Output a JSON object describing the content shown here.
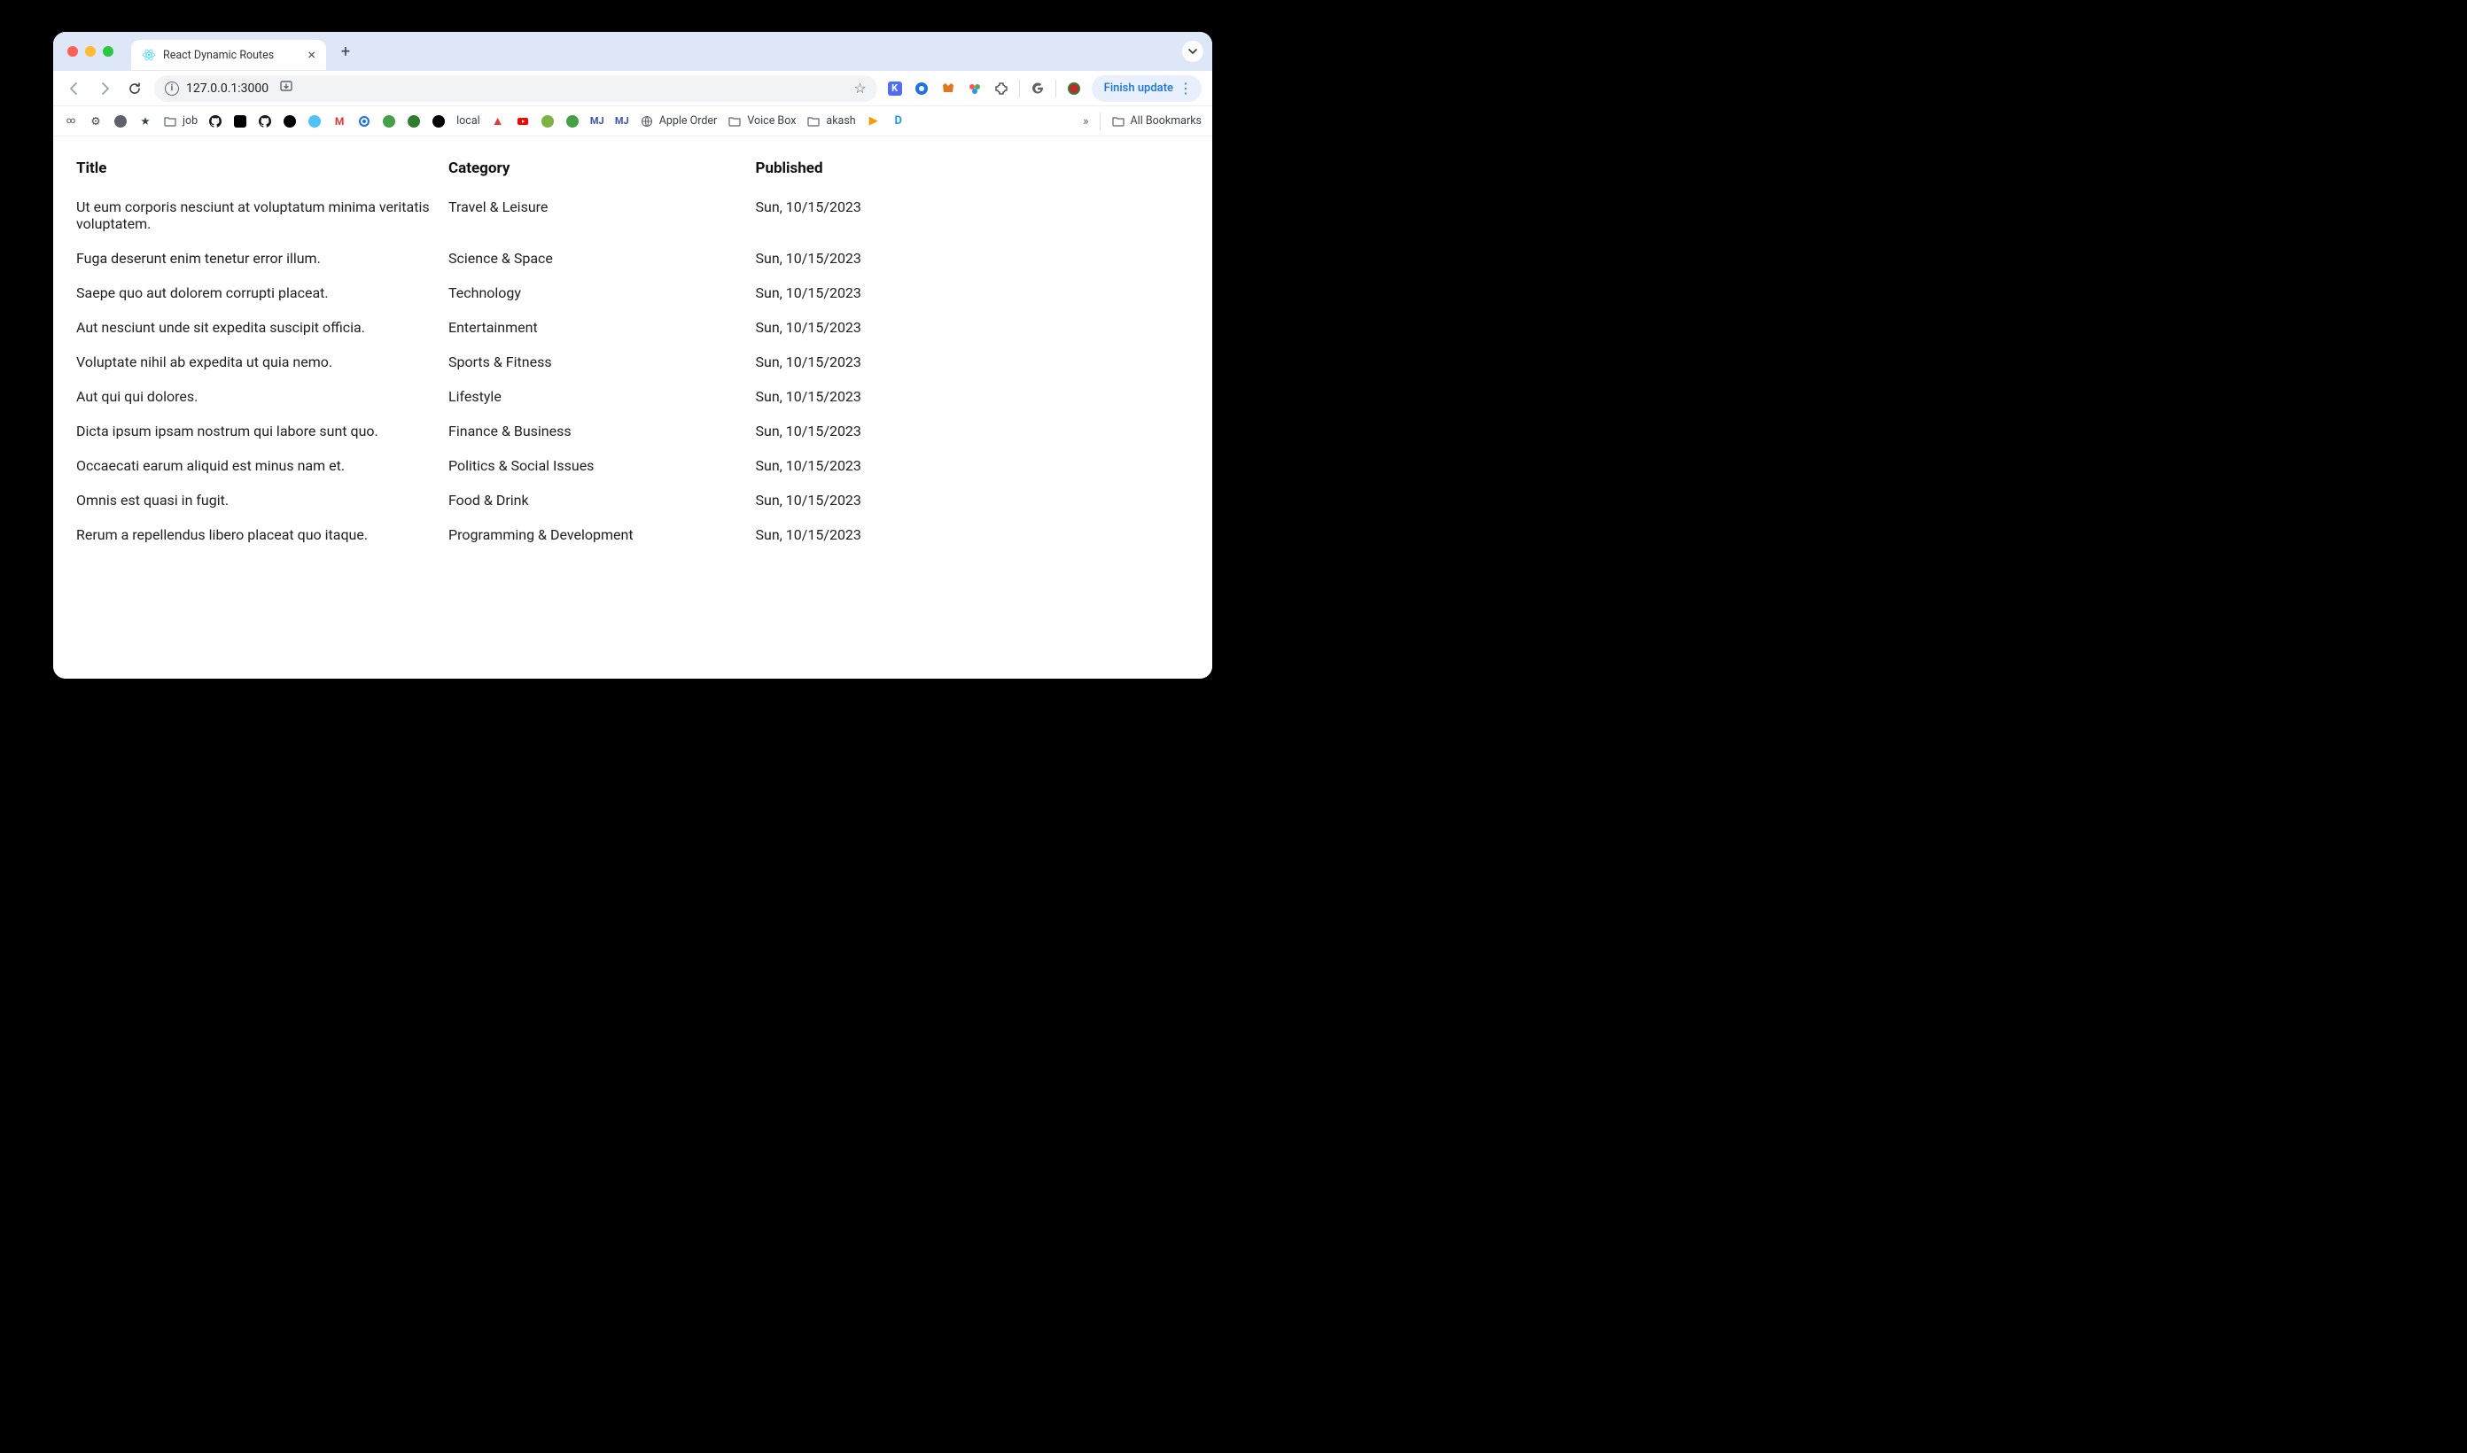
{
  "browser": {
    "tab_title": "React Dynamic Routes",
    "url": "127.0.0.1:3000",
    "finish_update_label": "Finish update"
  },
  "bookmarks": {
    "items": [
      {
        "label": "job"
      },
      {
        "label": "local"
      },
      {
        "label": "Apple Order"
      },
      {
        "label": "Voice Box"
      },
      {
        "label": "akash"
      }
    ],
    "all_label": "All Bookmarks"
  },
  "table": {
    "headers": {
      "title": "Title",
      "category": "Category",
      "published": "Published"
    },
    "rows": [
      {
        "title": "Ut eum corporis nesciunt at voluptatum minima veritatis voluptatem.",
        "category": "Travel & Leisure",
        "published": "Sun, 10/15/2023"
      },
      {
        "title": "Fuga deserunt enim tenetur error illum.",
        "category": "Science & Space",
        "published": "Sun, 10/15/2023"
      },
      {
        "title": "Saepe quo aut dolorem corrupti placeat.",
        "category": "Technology",
        "published": "Sun, 10/15/2023"
      },
      {
        "title": "Aut nesciunt unde sit expedita suscipit officia.",
        "category": "Entertainment",
        "published": "Sun, 10/15/2023"
      },
      {
        "title": "Voluptate nihil ab expedita ut quia nemo.",
        "category": "Sports & Fitness",
        "published": "Sun, 10/15/2023"
      },
      {
        "title": "Aut qui qui dolores.",
        "category": "Lifestyle",
        "published": "Sun, 10/15/2023"
      },
      {
        "title": "Dicta ipsum ipsam nostrum qui labore sunt quo.",
        "category": "Finance & Business",
        "published": "Sun, 10/15/2023"
      },
      {
        "title": "Occaecati earum aliquid est minus nam et.",
        "category": "Politics & Social Issues",
        "published": "Sun, 10/15/2023"
      },
      {
        "title": "Omnis est quasi in fugit.",
        "category": "Food & Drink",
        "published": "Sun, 10/15/2023"
      },
      {
        "title": "Rerum a repellendus libero placeat quo itaque.",
        "category": "Programming & Development",
        "published": "Sun, 10/15/2023"
      }
    ]
  }
}
